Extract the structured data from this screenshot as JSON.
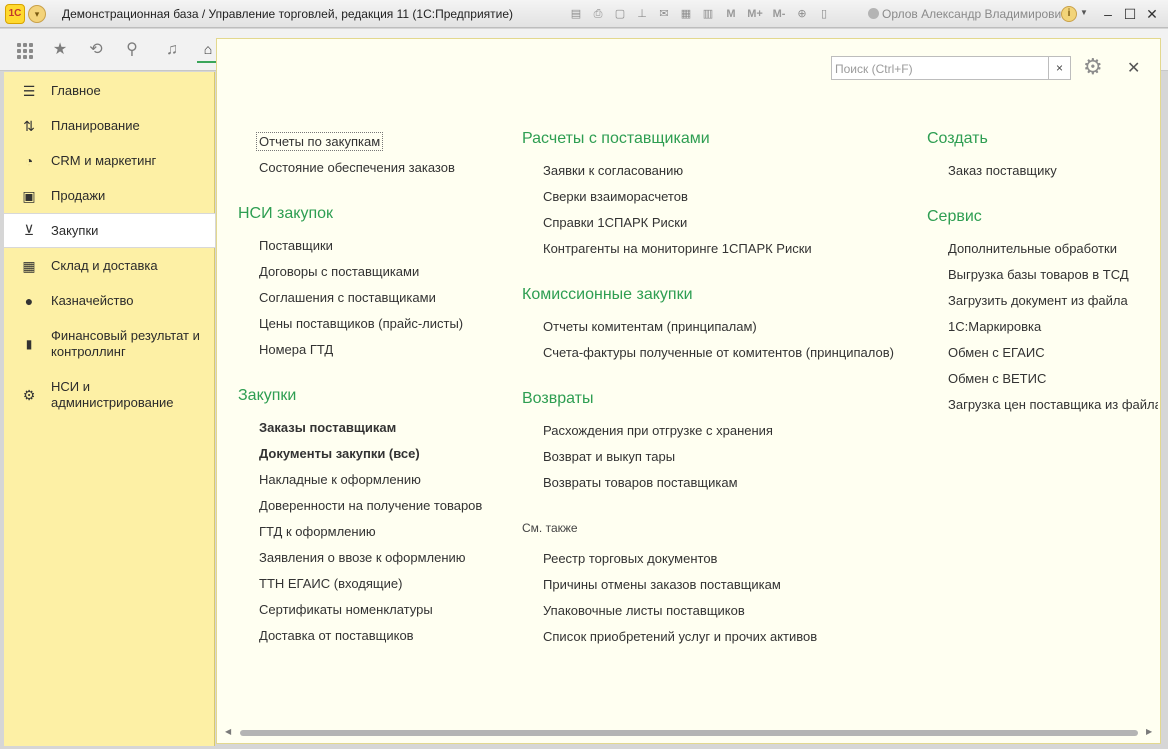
{
  "titlebar": {
    "logo": "1С",
    "title": "Демонстрационная база / Управление торговлей, редакция 11  (1С:Предприятие)",
    "m_buttons": [
      "M",
      "M+",
      "M-"
    ],
    "user": "Орлов Александр Владимирович",
    "info": "i",
    "icons": [
      "save-icon",
      "print-icon",
      "preview-icon",
      "stamp-icon",
      "mail-icon",
      "calendar-icon",
      "calculator-icon",
      "zoom-icon",
      "window-icon"
    ]
  },
  "toolbar": {
    "icons": [
      "apps-grid-icon",
      "star-icon",
      "history-icon",
      "search-icon",
      "bell-icon",
      "home-icon"
    ]
  },
  "sidebar": {
    "items": [
      {
        "label": "Главное",
        "icon": "menu-icon"
      },
      {
        "label": "Планирование",
        "icon": "planning-icon"
      },
      {
        "label": "CRM и маркетинг",
        "icon": "crm-icon"
      },
      {
        "label": "Продажи",
        "icon": "bag-icon"
      },
      {
        "label": "Закупки",
        "icon": "cart-icon",
        "active": true
      },
      {
        "label": "Склад и доставка",
        "icon": "warehouse-icon"
      },
      {
        "label": "Казначейство",
        "icon": "ruble-icon"
      },
      {
        "label": "Финансовый результат и контроллинг",
        "icon": "chart-icon"
      },
      {
        "label": "НСИ и администрирование",
        "icon": "gear-icon"
      }
    ]
  },
  "search": {
    "placeholder": "Поиск (Ctrl+F)",
    "clear": "×"
  },
  "main": {
    "col1": {
      "top_links": [
        "Отчеты по закупкам",
        "Состояние обеспечения заказов"
      ],
      "nsi_heading": "НСИ закупок",
      "nsi_links": [
        "Поставщики",
        "Договоры с поставщиками",
        "Соглашения с поставщиками",
        "Цены поставщиков (прайс-листы)",
        "Номера ГТД"
      ],
      "purchases_heading": "Закупки",
      "purchases_links": [
        "Заказы поставщикам",
        "Документы закупки (все)",
        "Накладные к оформлению",
        "Доверенности на получение товаров",
        "ГТД к оформлению",
        "Заявления о ввозе к оформлению",
        "ТТН ЕГАИС (входящие)",
        "Сертификаты номенклатуры",
        "Доставка от поставщиков"
      ]
    },
    "col2": {
      "settlements_heading": "Расчеты с поставщиками",
      "settlements_links": [
        "Заявки к согласованию",
        "Сверки взаиморасчетов",
        "Справки 1СПАРК Риски",
        "Контрагенты на мониторинге 1СПАРК Риски"
      ],
      "commission_heading": "Комиссионные закупки",
      "commission_links": [
        "Отчеты комитентам (принципалам)",
        "Счета-фактуры полученные от комитентов (принципалов)"
      ],
      "returns_heading": "Возвраты",
      "returns_links": [
        "Расхождения при отгрузке с хранения",
        "Возврат и выкуп тары",
        "Возвраты товаров поставщикам"
      ],
      "see_also_heading": "См. также",
      "see_also_links": [
        "Реестр торговых документов",
        "Причины отмены заказов поставщикам",
        "Упаковочные листы поставщиков",
        "Список приобретений услуг и прочих активов"
      ]
    },
    "col3": {
      "create_heading": "Создать",
      "create_links": [
        "Заказ поставщику"
      ],
      "service_heading": "Сервис",
      "service_links": [
        "Дополнительные обработки",
        "Выгрузка базы товаров в ТСД",
        "Загрузить документ из файла",
        "1С:Маркировка",
        "Обмен с ЕГАИС",
        "Обмен с ВЕТИС",
        "Загрузка цен поставщика из файла"
      ]
    }
  },
  "colors": {
    "heading": "#2e9e52",
    "sidebar_bg": "#fdf0a5",
    "panel_bg": "#fffff1"
  }
}
